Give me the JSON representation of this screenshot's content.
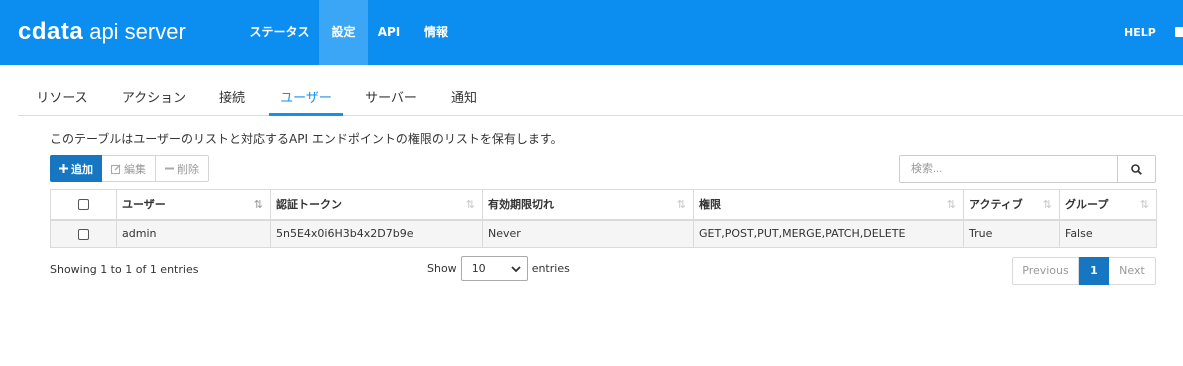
{
  "brand": {
    "logo_text": "cdata",
    "product": "api server",
    "colors": {
      "navbar": "#0c8df0",
      "nav_active": "#3aa6f5",
      "primary": "#1676c2",
      "tab_active": "#1a8fe6"
    }
  },
  "nav": {
    "items": [
      {
        "label": "ステータス"
      },
      {
        "label": "設定"
      },
      {
        "label": "API"
      },
      {
        "label": "情報"
      }
    ],
    "active": "設定",
    "help": "HELP",
    "logout_icon": "logout-icon"
  },
  "tabs": {
    "items": [
      {
        "label": "リソース"
      },
      {
        "label": "アクション"
      },
      {
        "label": "接続"
      },
      {
        "label": "ユーザー"
      },
      {
        "label": "サーバー"
      },
      {
        "label": "通知"
      }
    ],
    "active": "ユーザー"
  },
  "description": "このテーブルはユーザーのリストと対応するAPI エンドポイントの権限のリストを保有します。",
  "toolbar": {
    "add_label": "追加",
    "add_icon": "plus-icon",
    "edit_label": "編集",
    "edit_icon": "edit-icon",
    "delete_label": "削除",
    "delete_icon": "minus-icon"
  },
  "search": {
    "placeholder": "検索...",
    "value": "",
    "icon": "search-icon"
  },
  "table": {
    "columns": [
      "ユーザー",
      "認証トークン",
      "有効期限切れ",
      "権限",
      "アクティブ",
      "グループ"
    ],
    "sorted_column": "ユーザー",
    "sort_direction": "ascending",
    "rows": [
      {
        "checked": false,
        "cells": [
          "admin",
          "5n5E4x0i6H3b4x2D7b9e",
          "Never",
          "GET,POST,PUT,MERGE,PATCH,DELETE",
          "True",
          "False"
        ]
      }
    ]
  },
  "footer": {
    "info": "Showing 1 to 1 of 1 entries",
    "show_label": "Show",
    "page_size": "10",
    "entries_label": "entries",
    "previous": "Previous",
    "current_page": "1",
    "next": "Next"
  }
}
